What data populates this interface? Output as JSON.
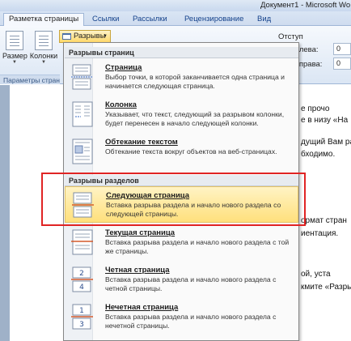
{
  "window": {
    "title": "Документ1 - Microsoft Wo"
  },
  "ribbon_tabs": [
    "Разметка страницы",
    "Ссылки",
    "Рассылки",
    "Рецензирование",
    "Вид"
  ],
  "ribbon": {
    "size_label": "Размер",
    "columns_label": "Колонки",
    "group_label": "Параметры стран",
    "breaks_label": "Разрывы",
    "indent_title": "Отступ",
    "left_label": "Слева:",
    "left_value": "0",
    "right_label": "Справа:",
    "right_value": "0"
  },
  "menu": {
    "page_breaks_header": "Разрывы страниц",
    "section_breaks_header": "Разрывы разделов",
    "page_items": [
      {
        "title": "Страница",
        "desc": "Выбор точки, в которой заканчивается одна страница и начинается следующая страница.",
        "icon": "page-break-icon"
      },
      {
        "title": "Колонка",
        "desc": "Указывает, что текст, следующий за разрывом колонки, будет перенесен в начало следующей колонки.",
        "icon": "column-break-icon"
      },
      {
        "title": "Обтекание текстом",
        "desc": "Обтекание текста вокруг объектов на веб-страницах.",
        "icon": "text-wrapping-icon"
      }
    ],
    "section_items": [
      {
        "title": "Следующая страница",
        "desc": "Вставка разрыва раздела и начало нового раздела со следующей страницы.",
        "icon": "next-page-icon"
      },
      {
        "title": "Текущая страница",
        "desc": "Вставка разрыва раздела и начало нового раздела с той же страницы.",
        "icon": "continuous-icon"
      },
      {
        "title": "Четная страница",
        "desc": "Вставка разрыва раздела и начало нового раздела с четной страницы.",
        "icon": "even-page-icon"
      },
      {
        "title": "Нечетная страница",
        "desc": "Вставка разрыва раздела и начало нового раздела с нечетной страницы.",
        "icon": "odd-page-icon"
      }
    ]
  },
  "document_fragments": [
    "е прочо",
    "е в низу «На",
    "дущий Вам разм",
    "бходимо.",
    "ормат стран",
    "иентация.",
    "ой, уста",
    "кмите «Разры"
  ]
}
